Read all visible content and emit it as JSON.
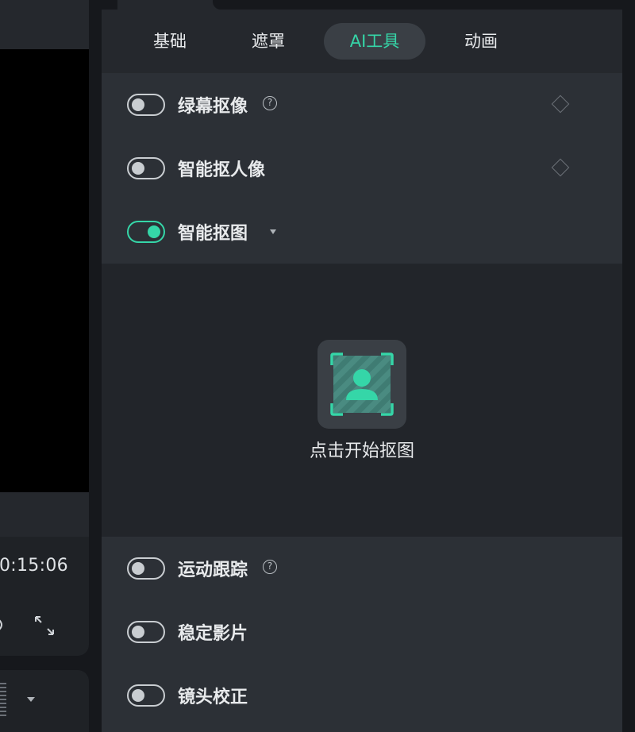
{
  "preview": {
    "timecode": "0:15:06",
    "icons": [
      "volume-icon",
      "fullscreen-icon",
      "grip-icon",
      "dropdown-icon"
    ]
  },
  "tabs": [
    {
      "label": "基础",
      "active": false
    },
    {
      "label": "遮罩",
      "active": false
    },
    {
      "label": "AI工具",
      "active": true
    },
    {
      "label": "动画",
      "active": false
    }
  ],
  "ai_tools": {
    "green_screen": {
      "label": "绿幕抠像",
      "on": false,
      "has_help": true,
      "has_keyframe": true
    },
    "portrait_cutout": {
      "label": "智能抠人像",
      "on": false,
      "has_keyframe": true
    },
    "smart_cutout": {
      "label": "智能抠图",
      "on": true,
      "has_caret": true
    },
    "start_cutout": {
      "label": "点击开始抠图",
      "icon": "portrait-cutout-icon"
    },
    "motion_tracking": {
      "label": "运动跟踪",
      "on": false,
      "has_help": true
    },
    "stabilization": {
      "label": "稳定影片",
      "on": false
    },
    "lens_correction": {
      "label": "镜头校正",
      "on": false
    }
  },
  "colors": {
    "accent": "#35d6a8",
    "panel_bg": "#25282d",
    "row_bg": "#2c3036",
    "subpanel_bg": "#22252a",
    "tab_active_bg": "#3a3f45"
  }
}
